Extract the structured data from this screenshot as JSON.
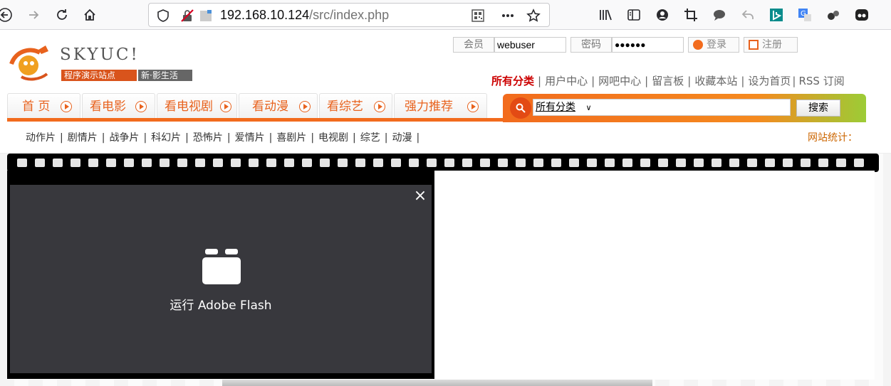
{
  "browser": {
    "url_host": "192.168.10.124",
    "url_path": "/src/index.php"
  },
  "logo": {
    "brand": "SKYUC!",
    "tagline_1": "程序演示站点",
    "tagline_2": "新·影生活"
  },
  "login": {
    "member_label": "会员",
    "member_value": "webuser",
    "password_label": "密码",
    "password_value": "●●●●●●",
    "login_button": "登录",
    "register_button": "注册"
  },
  "toplinks": [
    "所有分类",
    "用户中心",
    "网吧中心",
    "留言板",
    "收藏本站",
    "设为首页",
    "RSS 订阅"
  ],
  "nav_tabs": [
    "首 页",
    "看电影",
    "看电视剧",
    "看动漫",
    "看综艺",
    "强力推荐"
  ],
  "search": {
    "select_value": "所有分类",
    "button_label": "搜索"
  },
  "categories": [
    "动作片",
    "剧情片",
    "战争片",
    "科幻片",
    "恐怖片",
    "爱情片",
    "喜剧片",
    "电视剧",
    "综艺",
    "动漫"
  ],
  "stats_label": "网站统计：",
  "flash": {
    "label": "运行 Adobe Flash",
    "close_symbol": "×"
  },
  "colors": {
    "accent": "#f26b1d",
    "link_active": "#cc0000",
    "flash_bg": "#38383d"
  }
}
